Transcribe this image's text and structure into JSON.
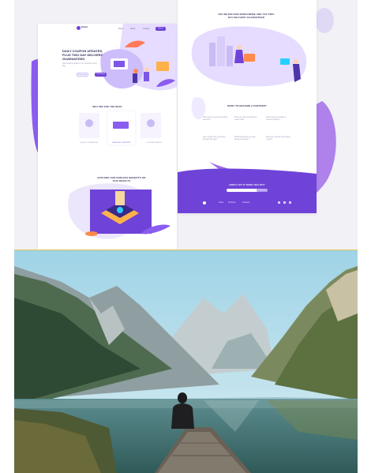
{
  "left_page": {
    "brand": "Brand",
    "nav": [
      "Home",
      "About",
      "Contact"
    ],
    "nav_button": "Sign in",
    "hero_title": "DAILY COUPON UPDATES, PLUS TWO DAY DELIVERY GUARANTEED",
    "hero_desc": "Get Amazing deals on our products every day.",
    "hero_buttons": [
      "Learn more",
      "Get started"
    ],
    "why_title": "WHY WE ARE THE BEST",
    "features": [
      "QUALITY GUARANTEED",
      "FREE CALL & DELIVERY",
      "CUSTOMER SERVICE"
    ],
    "explore_title": "EXPLORE OUR ENDLESS BENEFITS OR OUR RESULTS"
  },
  "right_page": {
    "header": "YES WE DELIVER WORLDWIDE AND YES TWO-DAY DELIVERY GUARANTEED",
    "partner_title": "WANT TO BECOME A PARTNER?",
    "questions": [
      "How can I set up an Amazing account?",
      "How can I buy products by credit card?",
      "How long does it take to receive product?",
      "Can I order from my phone through the app?",
      "What benefits do you get being a member?",
      "How can I refund the product I order?"
    ],
    "subscribe_title": "DON'T LET IT PASS YOU OUT",
    "subscribe_button": "Subscribe",
    "footer_links": [
      "Home",
      "Products",
      "Contacts"
    ],
    "social_icons": [
      "facebook-icon",
      "twitter-icon",
      "instagram-icon"
    ]
  },
  "colors": {
    "accent": "#6f43d8",
    "accent_light": "#b59bf2",
    "dark_text": "#2f2f5a",
    "divider": "#e8c74a"
  }
}
